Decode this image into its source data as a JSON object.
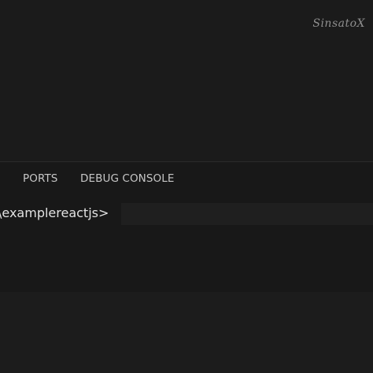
{
  "watermark": "SinsatoX",
  "panel": {
    "tabs": [
      {
        "label": "PORTS"
      },
      {
        "label": "DEBUG CONSOLE"
      }
    ]
  },
  "terminal": {
    "prompt": "\\examplereactjs>"
  }
}
